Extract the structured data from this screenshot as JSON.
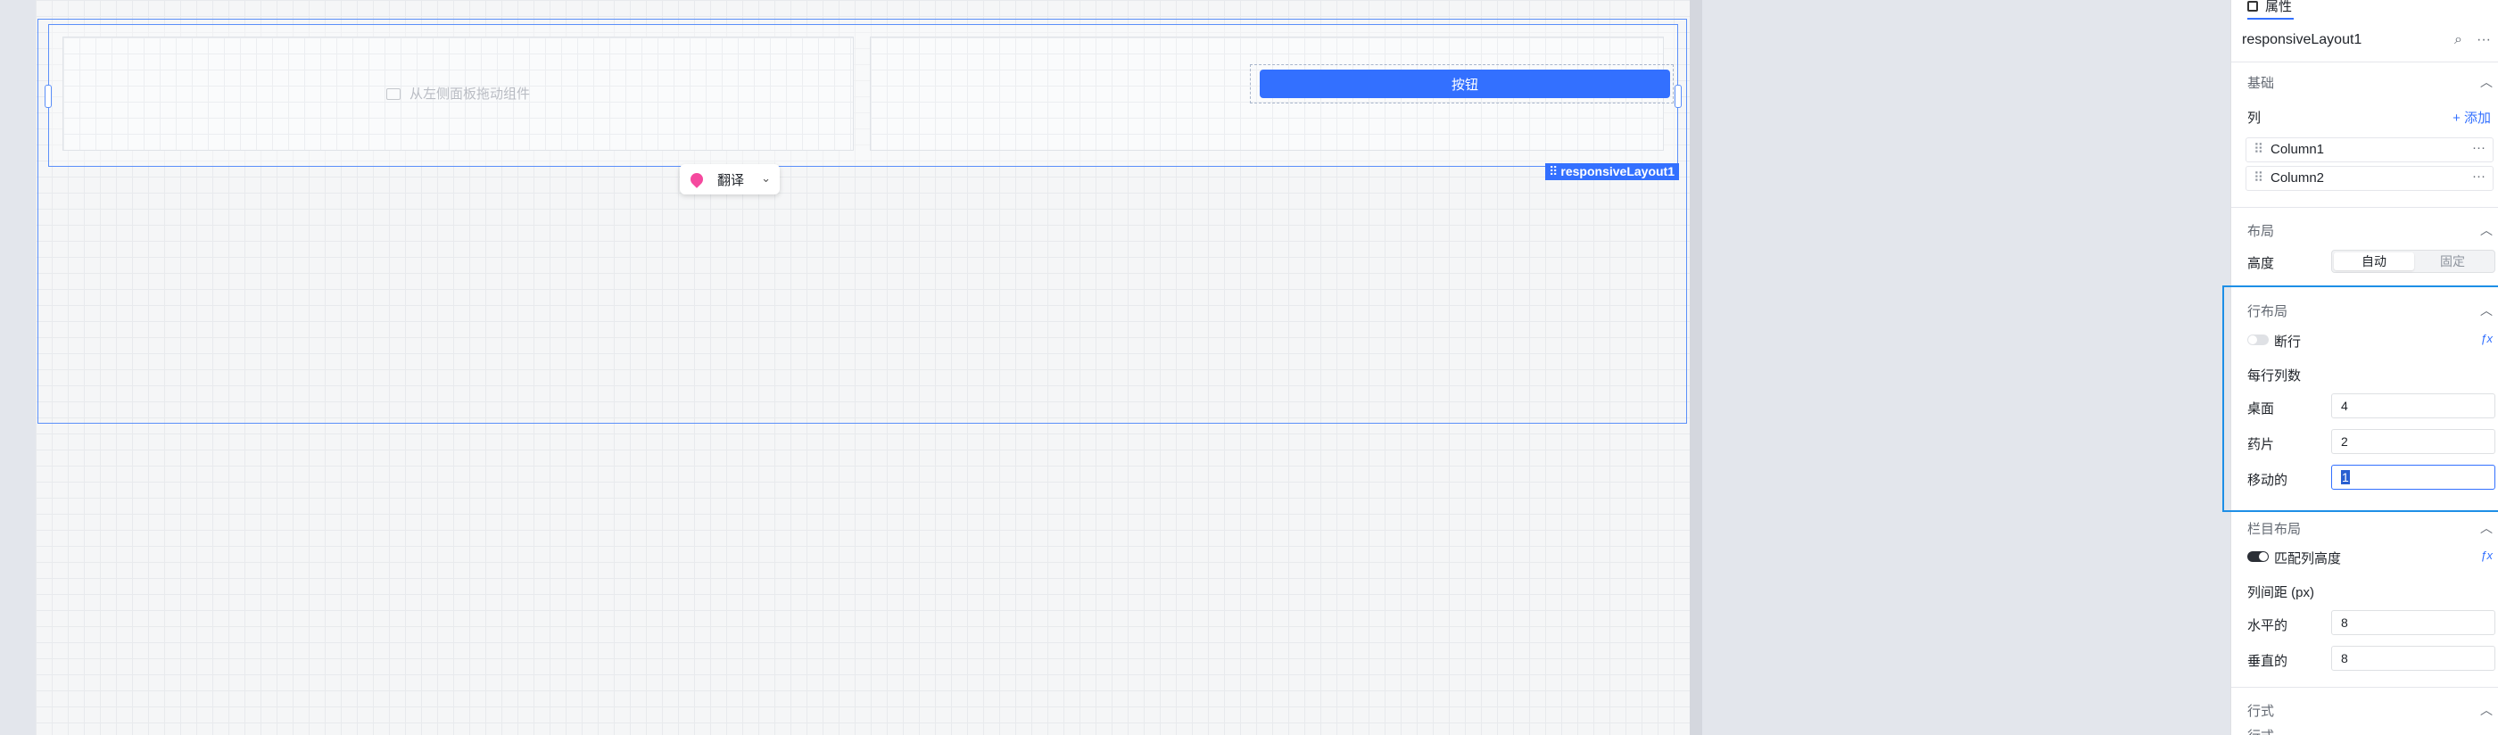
{
  "canvas": {
    "empty_hint": "从左侧面板拖动组件",
    "button_label": "按钮",
    "layout_tag": "responsiveLayout1",
    "translate_label": "翻译"
  },
  "panel": {
    "tab_label": "属性",
    "component_name": "responsiveLayout1",
    "basic": {
      "title": "基础",
      "columns_label": "列",
      "add_label": "+ 添加",
      "columns": [
        "Column1",
        "Column2"
      ]
    },
    "layout": {
      "title": "布局",
      "height_label": "高度",
      "height_options": [
        "自动",
        "固定"
      ],
      "height_selected": "自动"
    },
    "row_layout": {
      "title": "行布局",
      "wrap_label": "断行",
      "wrap_on": false,
      "per_row_label": "每行列数",
      "desktop_label": "桌面",
      "desktop_value": "4",
      "tablet_label": "药片",
      "tablet_value": "2",
      "mobile_label": "移动的",
      "mobile_value": "1"
    },
    "column_layout": {
      "title": "栏目布局",
      "match_height_label": "匹配列高度",
      "match_height_on": true,
      "gap_label": "列间距 (px)",
      "horizontal_label": "水平的",
      "horizontal_value": "8",
      "vertical_label": "垂直的",
      "vertical_value": "8"
    },
    "style": {
      "title": "行式",
      "partial_label": "行式"
    }
  },
  "colors": {
    "accent": "#3370ff",
    "selection": "#5b8ff9",
    "focus": "#1e8fe6"
  }
}
